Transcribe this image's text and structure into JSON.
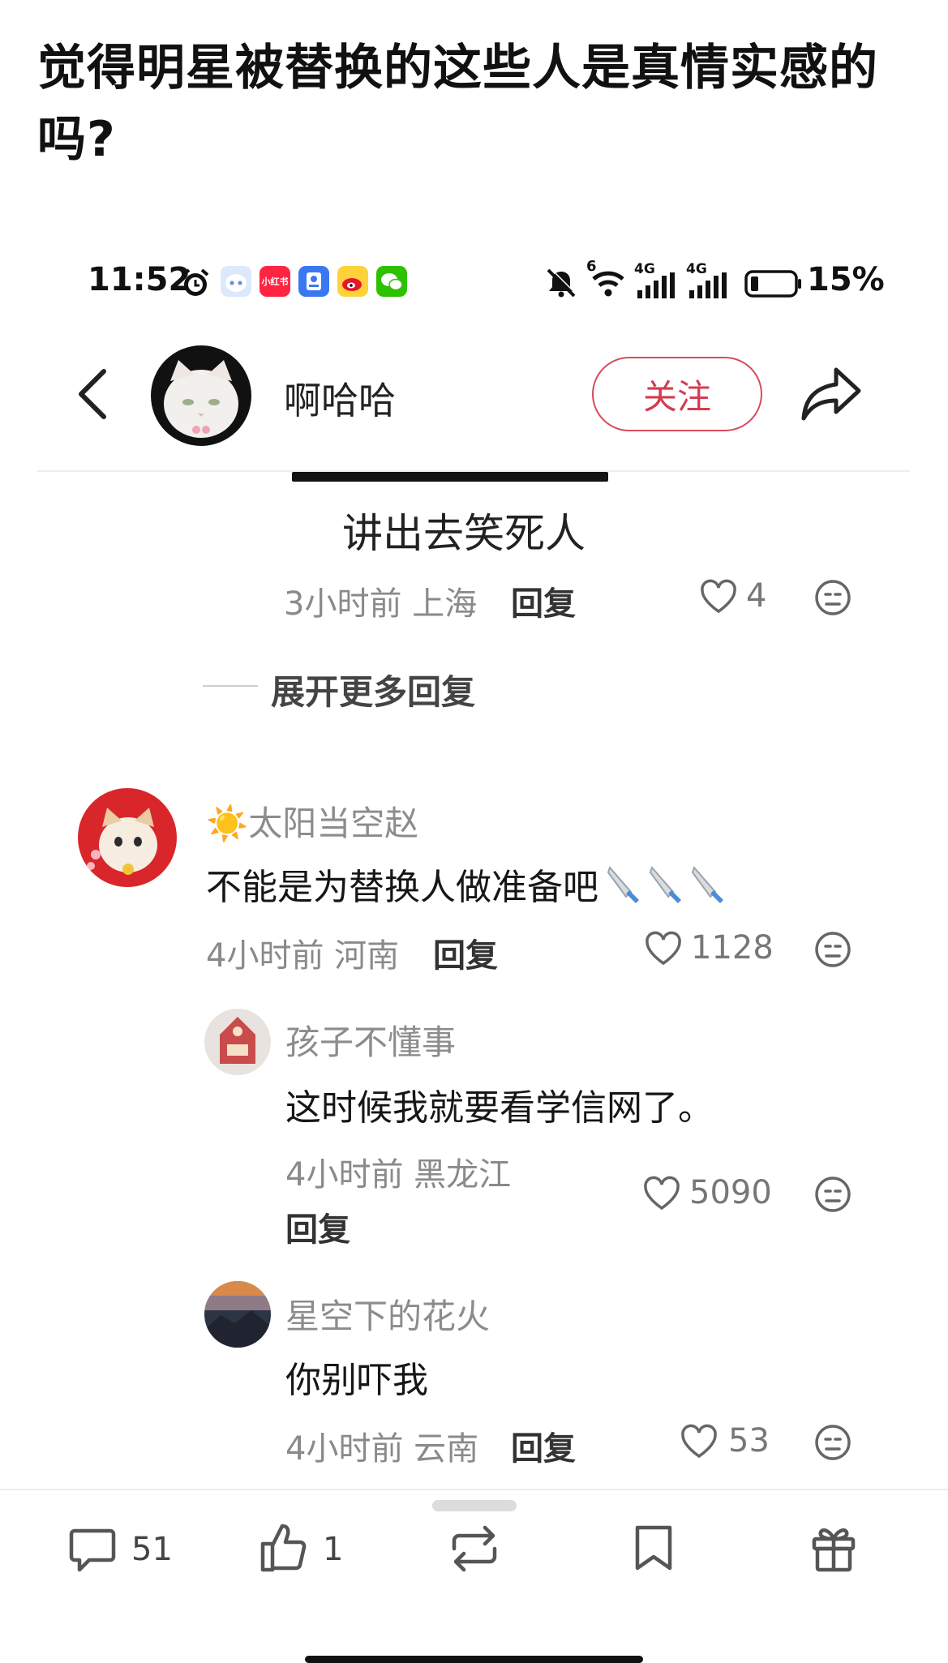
{
  "post": {
    "title": "觉得明星被替换的这些人是真情实感的吗?"
  },
  "status_bar": {
    "time": "11:52",
    "app_icons": [
      "bot-icon",
      "xiaohongshu-icon",
      "id-card-icon",
      "weibo-icon",
      "wechat-icon"
    ],
    "xhs_label": "小红书",
    "network_1": "4G",
    "network_2": "4G",
    "wifi_badge": "6",
    "battery": "15%"
  },
  "header": {
    "username": "啊哈哈",
    "follow_label": "关注"
  },
  "thread": {
    "image_caption": "讲出去笑死人",
    "first_reply": {
      "time": "3小时前",
      "location": "上海",
      "reply_label": "回复",
      "likes": "4"
    },
    "expand_label": "展开更多回复"
  },
  "comments": [
    {
      "username": "太阳当空赵",
      "username_prefix_emoji": "☀️",
      "text": "不能是为替换人做准备吧",
      "time": "4小时前",
      "location": "河南",
      "reply_label": "回复",
      "likes": "1128",
      "replies": [
        {
          "username": "孩子不懂事",
          "text": "这时候我就要看学信网了。",
          "time": "4小时前",
          "location": "黑龙江",
          "reply_label": "回复",
          "likes": "5090"
        },
        {
          "username": "星空下的花火",
          "text": "你别吓我",
          "time": "4小时前",
          "location": "云南",
          "reply_label": "回复",
          "likes": "53"
        }
      ]
    }
  ],
  "bottom_bar": {
    "comments_count": "51",
    "likes_count": "1"
  },
  "colors": {
    "follow_red": "#d43c4f",
    "text_dark": "#161616",
    "meta_gray": "#8a8a8a"
  }
}
